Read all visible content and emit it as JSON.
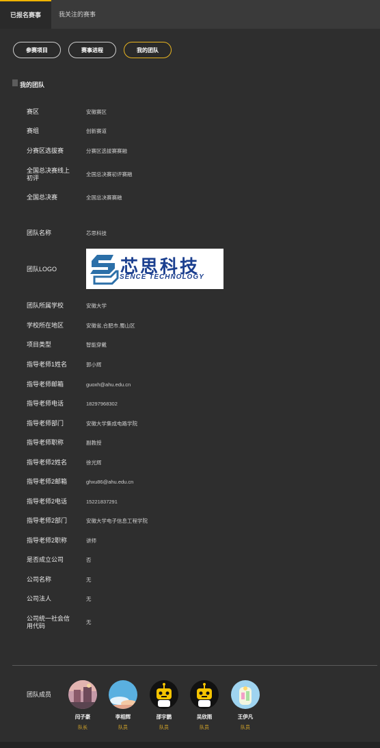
{
  "tabs": {
    "registered": "已报名赛事",
    "followed": "我关注的赛事"
  },
  "buttons": {
    "project": "参赛项目",
    "progress": "赛事进程",
    "team": "我的团队"
  },
  "section_title": "我的团队",
  "fields": [
    {
      "label": "赛区",
      "value": "安徽赛区"
    },
    {
      "label": "赛组",
      "value": "创新赛道"
    },
    {
      "label": "分赛区选拔赛",
      "value": "分赛区选拔赛赛融"
    },
    {
      "label": "全国总决赛线上初评",
      "value": "全国总决赛初评赛融"
    },
    {
      "label": "全国总决赛",
      "value": "全国总决赛赛融"
    },
    {
      "label": "团队名称",
      "value": "芯思科技"
    },
    {
      "label": "团队LOGO",
      "value": ""
    },
    {
      "label": "团队所属学校",
      "value": "安徽大学"
    },
    {
      "label": "学校所在地区",
      "value": "安徽省,合肥市,蜀山区"
    },
    {
      "label": "项目类型",
      "value": "智能穿戴"
    },
    {
      "label": "指导老师1姓名",
      "value": "郭小辉"
    },
    {
      "label": "指导老师邮箱",
      "value": "guoxh@ahu.edu.cn"
    },
    {
      "label": "指导老师电话",
      "value": "18297968302"
    },
    {
      "label": "指导老师部门",
      "value": "安徽大学集成电路学院"
    },
    {
      "label": "指导老师职称",
      "value": "副教授"
    },
    {
      "label": "指导老师2姓名",
      "value": "徐光辉"
    },
    {
      "label": "指导老师2邮箱",
      "value": "ghxu86@ahu.edu.cn"
    },
    {
      "label": "指导老师2电话",
      "value": "15221837291"
    },
    {
      "label": "指导老师2部门",
      "value": "安徽大学电子信息工程学院"
    },
    {
      "label": "指导老师2职称",
      "value": "讲师"
    },
    {
      "label": "是否成立公司",
      "value": "否"
    },
    {
      "label": "公司名称",
      "value": "无"
    },
    {
      "label": "公司法人",
      "value": "无"
    },
    {
      "label": "公司统一社会信用代码",
      "value": "无"
    }
  ],
  "logo": {
    "cn": "芯思科技",
    "en": "SENCE TECHNOLOGY",
    "brand_color": "#1b3f8f"
  },
  "members_label": "团队成员",
  "members": [
    {
      "name": "闫子豪",
      "role": "队长",
      "avatar": "landscape-avatar"
    },
    {
      "name": "李相辉",
      "role": "队员",
      "avatar": "sky-avatar"
    },
    {
      "name": "邵宇鹏",
      "role": "队员",
      "avatar": "robot-avatar"
    },
    {
      "name": "吴欣雨",
      "role": "队员",
      "avatar": "robot-avatar"
    },
    {
      "name": "王伊凡",
      "role": "队员",
      "avatar": "toy-avatar"
    }
  ],
  "colors": {
    "accent": "#e9b520",
    "background": "#2e2e2e"
  }
}
